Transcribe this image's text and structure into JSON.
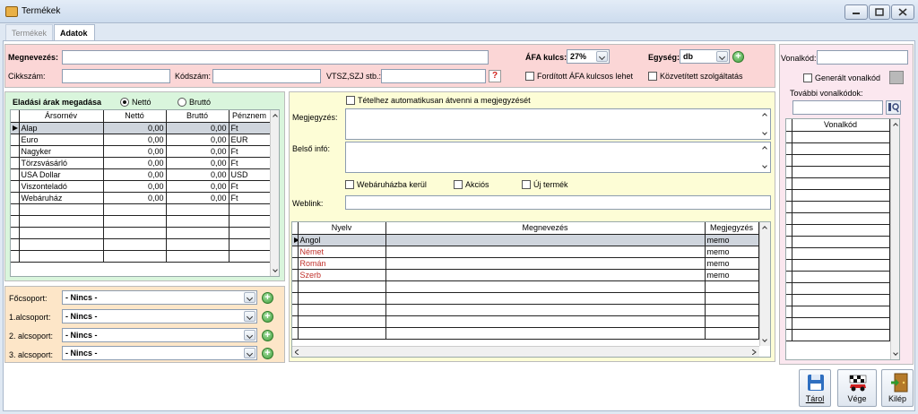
{
  "window": {
    "title": "Termékek"
  },
  "tabs": [
    {
      "label": "Termékek"
    },
    {
      "label": "Adatok"
    }
  ],
  "form": {
    "megnevezes_label": "Megnevezés:",
    "cikkszam_label": "Cikkszám:",
    "kodszam_label": "Kódszám:",
    "vtsz_label": "VTSZ,SZJ stb.:",
    "afa_label": "ÁFA kulcs:",
    "afa_value": "27%",
    "egyseg_label": "Egység:",
    "egyseg_value": "db",
    "forditott_afa": "Fordított ÁFA kulcsos lehet",
    "kozvetitett": "Közvetített szolgáltatás",
    "help_glyph": "?"
  },
  "prices": {
    "title": "Eladási árak megadása",
    "netto_radio": "Nettó",
    "brutto_radio": "Bruttó",
    "columns": [
      "Ársornév",
      "Nettó",
      "Bruttó",
      "Pénznem"
    ],
    "rows": [
      [
        "Alap",
        "0,00",
        "0,00",
        "Ft"
      ],
      [
        "Euro",
        "0,00",
        "0,00",
        "EUR"
      ],
      [
        "Nagyker",
        "0,00",
        "0,00",
        "Ft"
      ],
      [
        "Törzsvásárló",
        "0,00",
        "0,00",
        "Ft"
      ],
      [
        "USA Dollar",
        "0,00",
        "0,00",
        "USD"
      ],
      [
        "Viszonteladó",
        "0,00",
        "0,00",
        "Ft"
      ],
      [
        "Webáruház",
        "0,00",
        "0,00",
        "Ft"
      ]
    ]
  },
  "groups": {
    "items": [
      {
        "label": "Főcsoport:",
        "value": "- Nincs -"
      },
      {
        "label": "1.alcsoport:",
        "value": "- Nincs -"
      },
      {
        "label": "2. alcsoport:",
        "value": "- Nincs -"
      },
      {
        "label": "3. alcsoport:",
        "value": "- Nincs -"
      }
    ]
  },
  "info": {
    "auto_note": "Tételhez automatikusan átvenni a megjegyzését",
    "megjegyzes_label": "Megjegyzés:",
    "belso_label": "Belső infó:",
    "webaruhaz": "Webáruházba kerül",
    "akcios": "Akciós",
    "uj_termek": "Új termék",
    "weblink_label": "Weblink:"
  },
  "lang": {
    "columns": [
      "Nyelv",
      "Megnevezés",
      "Megjegyzés"
    ],
    "rows": [
      [
        "Angol",
        "",
        "memo"
      ],
      [
        "Német",
        "",
        "memo"
      ],
      [
        "Román",
        "",
        "memo"
      ],
      [
        "Szerb",
        "",
        "memo"
      ]
    ]
  },
  "barcode": {
    "vonalkod_label": "Vonalkód:",
    "generalt": "Generált vonalkód",
    "tovabbi": "További vonalkódok:",
    "col": "Vonalkód"
  },
  "actions": {
    "save": "Tárol",
    "end": "Vége",
    "exit": "Kilép"
  },
  "colors": {
    "pink": "#fbd6d6",
    "green": "#d9f5dc",
    "orange": "#fde6c8",
    "yellow": "#fdfdd6",
    "lightpink": "#fbe7ef"
  }
}
